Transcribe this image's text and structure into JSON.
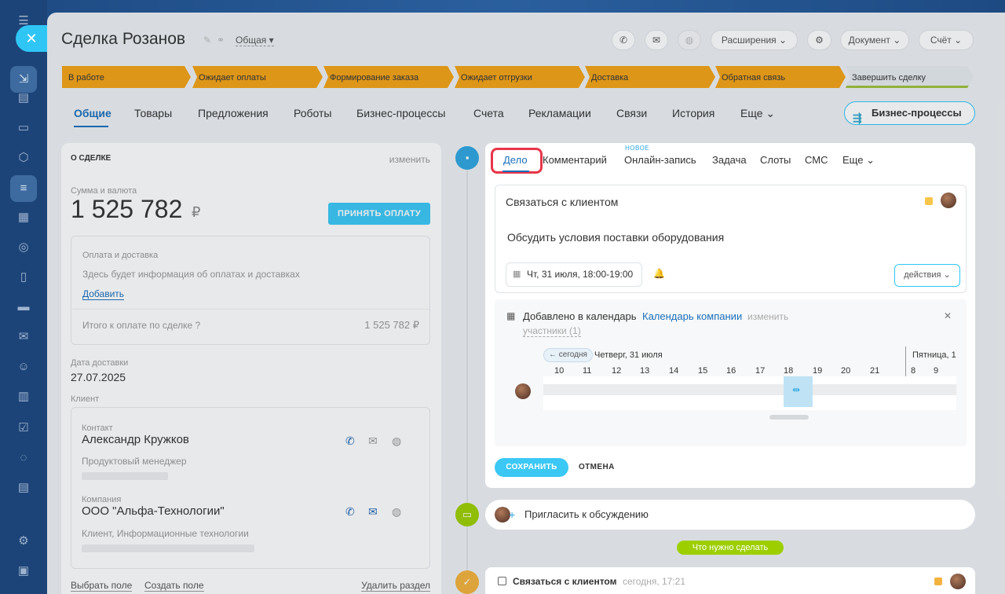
{
  "deal": {
    "title": "Сделка Розанов",
    "category": "Общая"
  },
  "toolbar": {
    "extensions": "Расширения",
    "document": "Документ",
    "invoice": "Счёт"
  },
  "stages": [
    "В работе",
    "Ожидает оплаты",
    "Формирование заказа",
    "Ожидает отгрузки",
    "Доставка",
    "Обратная связь",
    "Завершить сделку"
  ],
  "tabs": [
    "Общие",
    "Товары",
    "Предложения",
    "Роботы",
    "Бизнес-процессы",
    "Счета",
    "Рекламации",
    "Связи",
    "История",
    "Еще"
  ],
  "bp_button": "Бизнес-процессы",
  "about": {
    "header": "О СДЕЛКЕ",
    "edit": "изменить",
    "sum_label": "Сумма и валюта",
    "sum": "1 525 782",
    "currency": "₽",
    "pay_button": "ПРИНЯТЬ ОПЛАТУ",
    "payment_title": "Оплата и доставка",
    "payment_text": "Здесь будет информация об оплатах и доставках",
    "add": "Добавить",
    "total_label": "Итого к оплате по сделке",
    "total": "1 525 782 ₽",
    "delivery_label": "Дата доставки",
    "delivery_date": "27.07.2025",
    "client_label": "Клиент",
    "contact_label": "Контакт",
    "contact_name": "Александр Кружков",
    "contact_post": "Продуктовый менеджер",
    "company_label": "Компания",
    "company_name": "ООО \"Альфа-Технологии\"",
    "company_info": "Клиент, Информационные технологии",
    "select_field": "Выбрать поле",
    "create_field": "Создать поле",
    "delete_section": "Удалить раздел"
  },
  "activity": {
    "tabs": [
      "Дело",
      "Комментарий",
      "Онлайн-запись",
      "Задача",
      "Слоты",
      "СМС",
      "Еще"
    ],
    "new_badge": "НОВОЕ",
    "task_title": "Связаться с клиентом",
    "task_desc": "Обсудить условия поставки оборудования",
    "datetime": "Чт, 31 июля, 18:00-19:00",
    "actions": "действия",
    "cal_added": "Добавлено в календарь",
    "cal_name": "Календарь компании",
    "cal_change": "изменить",
    "participants": "участники (1)",
    "today": "сегодня",
    "day1": "Четверг, 31 июля",
    "day2": "Пятница, 1",
    "hours": [
      "10",
      "11",
      "12",
      "13",
      "14",
      "15",
      "16",
      "17",
      "18",
      "19",
      "20",
      "21",
      "8",
      "9"
    ],
    "save": "СОХРАНИТЬ",
    "cancel": "ОТМЕНА"
  },
  "invite": "Пригласить к обсуждению",
  "todo_badge": "Что нужно сделать",
  "todo_item": {
    "title": "Связаться с клиентом",
    "time": "сегодня, 17:21"
  },
  "colors": {
    "accent": "#2fc6f6",
    "stage": "#f3a315",
    "link": "#1a6fba",
    "green": "#9dcf00",
    "highlight": "#e8364a"
  }
}
